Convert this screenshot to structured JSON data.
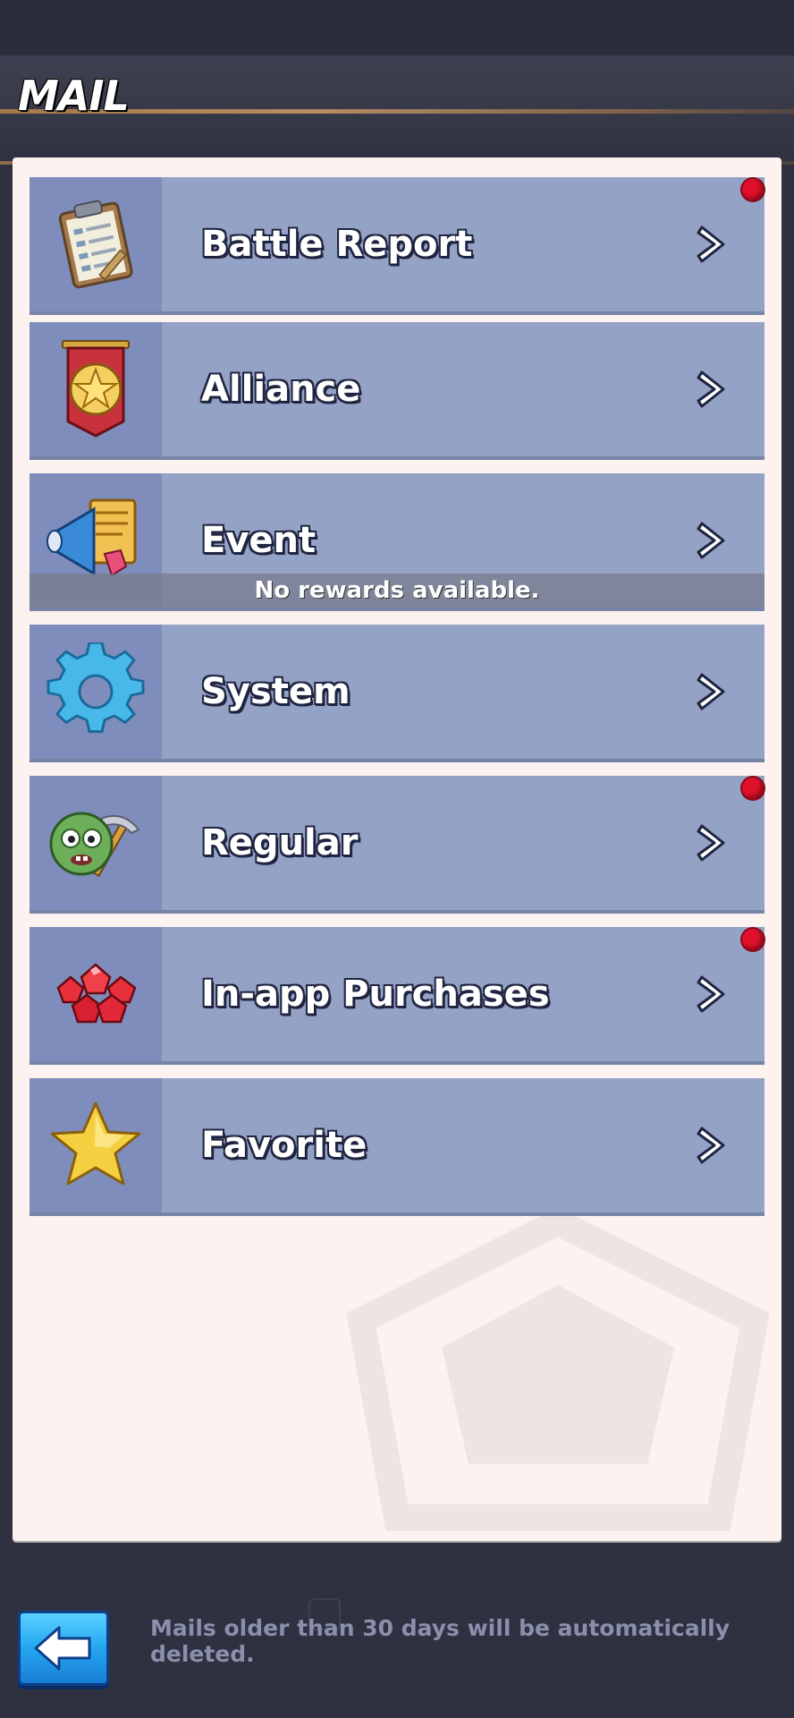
{
  "header": {
    "title": "MAIL"
  },
  "rows": [
    {
      "label": "Battle Report",
      "icon": "clipboard-icon",
      "badge": true
    },
    {
      "label": "Alliance",
      "icon": "alliance-banner-icon",
      "badge": false
    },
    {
      "label": "Event",
      "icon": "megaphone-icon",
      "badge": false,
      "note": "No rewards available."
    },
    {
      "label": "System",
      "icon": "gear-icon",
      "badge": false
    },
    {
      "label": "Regular",
      "icon": "zombie-pickaxe-icon",
      "badge": true
    },
    {
      "label": "In-app Purchases",
      "icon": "gems-icon",
      "badge": true
    },
    {
      "label": "Favorite",
      "icon": "star-icon",
      "badge": false
    }
  ],
  "footer": {
    "note": "Mails older than 30 days will be automatically deleted.",
    "back_icon": "back-arrow-icon"
  },
  "colors": {
    "row_bg": "#94a2c6",
    "icon_bg": "#7f8dbc",
    "badge": "#e0102a",
    "panel": "#fcf3f1",
    "back_button": "#24a6f0"
  }
}
